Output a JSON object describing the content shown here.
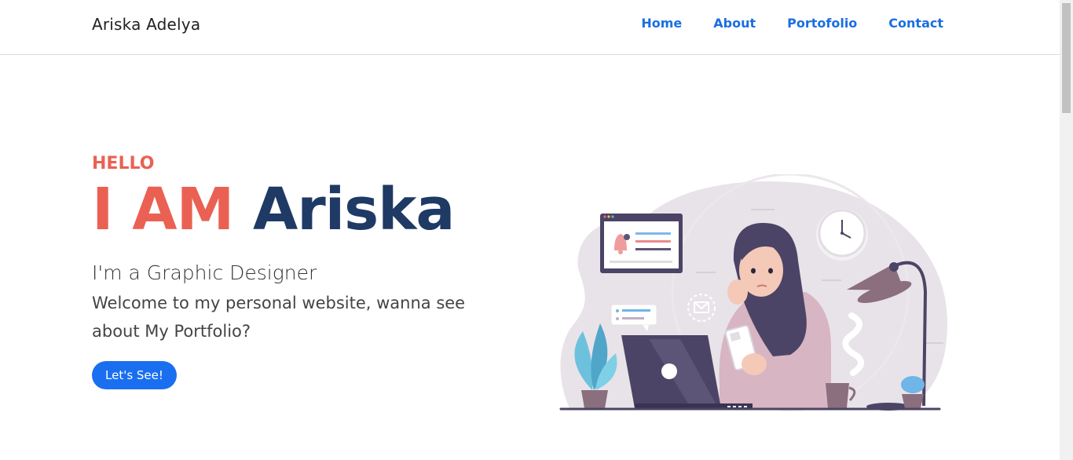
{
  "brand": "Ariska Adelya",
  "nav": [
    "Home",
    "About",
    "Portofolio",
    "Contact"
  ],
  "hero": {
    "greeting": "HELLO",
    "headline_accent": "I AM",
    "headline_name": "Ariska",
    "role": "I'm a Graphic Designer",
    "intro": "Welcome to my personal website, wanna see about My Portfolio?",
    "cta_label": "Let's See!"
  },
  "colors": {
    "accent": "#ea6153",
    "navy": "#1f3a64",
    "link": "#1a6fe0",
    "button": "#1a6ff0"
  },
  "icons": [
    "clock-icon",
    "desk-lamp-icon",
    "laptop-icon",
    "plant-icon",
    "coffee-cup-icon",
    "notification-bell-icon",
    "mail-icon",
    "smartphone-icon"
  ]
}
